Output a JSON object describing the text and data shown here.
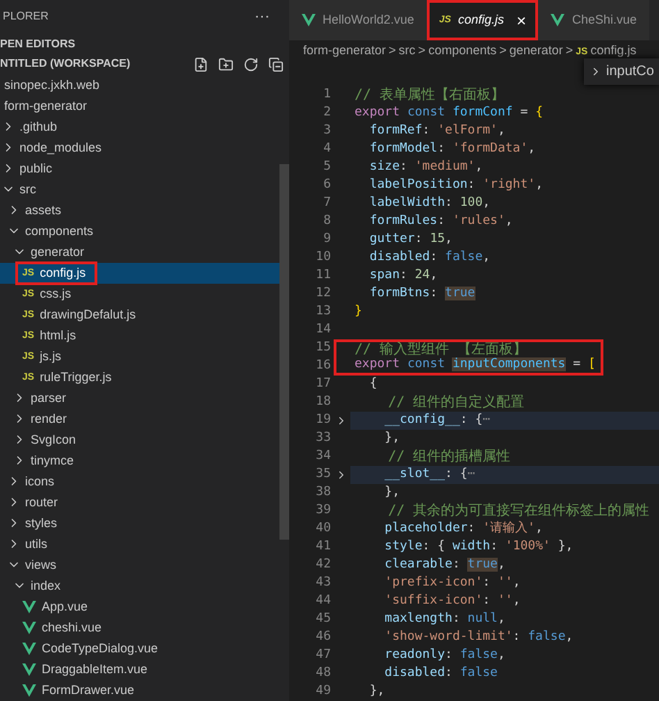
{
  "sidebar": {
    "title": "PLORER",
    "more": "···",
    "open_editors": "PEN EDITORS",
    "workspace": "NTITLED (WORKSPACE)",
    "tree": [
      {
        "label": "sinopec.jxkh.web",
        "kind": "root",
        "selected": false
      },
      {
        "label": "form-generator",
        "kind": "root",
        "selected": false,
        "children": [
          {
            "label": ".github",
            "kind": "folder",
            "expanded": false,
            "selected": false
          },
          {
            "label": "node_modules",
            "kind": "folder",
            "expanded": false,
            "selected": false
          },
          {
            "label": "public",
            "kind": "folder",
            "expanded": false,
            "selected": false
          },
          {
            "label": "src",
            "kind": "folder",
            "expanded": true,
            "selected": false,
            "children": [
              {
                "label": "assets",
                "kind": "folder",
                "expanded": false,
                "selected": false
              },
              {
                "label": "components",
                "kind": "folder",
                "expanded": true,
                "selected": false,
                "children": [
                  {
                    "label": "generator",
                    "kind": "folder",
                    "expanded": true,
                    "selected": false,
                    "children": [
                      {
                        "label": "config.js",
                        "kind": "js",
                        "badge": "JS",
                        "selected": true,
                        "annotated": true
                      },
                      {
                        "label": "css.js",
                        "kind": "js",
                        "badge": "JS",
                        "selected": false,
                        "annotated": false
                      },
                      {
                        "label": "drawingDefalut.js",
                        "kind": "js",
                        "badge": "JS",
                        "selected": false,
                        "annotated": false
                      },
                      {
                        "label": "html.js",
                        "kind": "js",
                        "badge": "JS",
                        "selected": false,
                        "annotated": false
                      },
                      {
                        "label": "js.js",
                        "kind": "js",
                        "badge": "JS",
                        "selected": false,
                        "annotated": false
                      },
                      {
                        "label": "ruleTrigger.js",
                        "kind": "js",
                        "badge": "JS",
                        "selected": false,
                        "annotated": false
                      }
                    ]
                  },
                  {
                    "label": "parser",
                    "kind": "folder",
                    "expanded": false,
                    "selected": false
                  },
                  {
                    "label": "render",
                    "kind": "folder",
                    "expanded": false,
                    "selected": false
                  },
                  {
                    "label": "SvgIcon",
                    "kind": "folder",
                    "expanded": false,
                    "selected": false
                  },
                  {
                    "label": "tinymce",
                    "kind": "folder",
                    "expanded": false,
                    "selected": false
                  }
                ]
              },
              {
                "label": "icons",
                "kind": "folder",
                "expanded": false,
                "selected": false
              },
              {
                "label": "router",
                "kind": "folder",
                "expanded": false,
                "selected": false
              },
              {
                "label": "styles",
                "kind": "folder",
                "expanded": false,
                "selected": false
              },
              {
                "label": "utils",
                "kind": "folder",
                "expanded": false,
                "selected": false
              },
              {
                "label": "views",
                "kind": "folder",
                "expanded": true,
                "selected": false,
                "children": [
                  {
                    "label": "index",
                    "kind": "folder",
                    "expanded": true,
                    "selected": false,
                    "children": [
                      {
                        "label": "App.vue",
                        "kind": "vue",
                        "selected": false,
                        "annotated": false
                      },
                      {
                        "label": "cheshi.vue",
                        "kind": "vue",
                        "selected": false,
                        "annotated": false
                      },
                      {
                        "label": "CodeTypeDialog.vue",
                        "kind": "vue",
                        "selected": false,
                        "annotated": false
                      },
                      {
                        "label": "DraggableItem.vue",
                        "kind": "vue",
                        "selected": false,
                        "annotated": false
                      },
                      {
                        "label": "FormDrawer.vue",
                        "kind": "vue",
                        "selected": false,
                        "annotated": false
                      }
                    ]
                  }
                ]
              }
            ]
          }
        ]
      }
    ]
  },
  "tabs": [
    {
      "label": "HelloWorld2.vue",
      "kind": "vue",
      "selected": false,
      "annotated": false
    },
    {
      "label": "config.js",
      "kind": "js",
      "badge": "JS",
      "selected": true,
      "annotated": true,
      "close": "×"
    },
    {
      "label": "CheShi.vue",
      "kind": "vue",
      "selected": false,
      "annotated": false
    }
  ],
  "breadcrumb": [
    {
      "label": "form-generator",
      "separator": ">"
    },
    {
      "label": "src",
      "separator": ">"
    },
    {
      "label": "components",
      "separator": ">"
    },
    {
      "label": "generator",
      "separator": ">"
    },
    {
      "label": "config.js",
      "badge": "JS"
    }
  ],
  "outline_popup": {
    "label": "inputCo"
  },
  "code": [
    {
      "number": "1",
      "boxed": false,
      "tokens": [
        {
          "kind": "comment",
          "s": "// 表单属性【右面板】"
        }
      ]
    },
    {
      "number": "2",
      "boxed": false,
      "tokens": [
        {
          "kind": "keyword",
          "s": "export "
        },
        {
          "kind": "storage",
          "s": "const "
        },
        {
          "kind": "variable",
          "s": "formConf"
        },
        {
          "kind": "punct",
          "s": " = "
        },
        {
          "kind": "bracket",
          "s": "{"
        }
      ]
    },
    {
      "number": "3",
      "boxed": false,
      "tokens": [
        {
          "kind": "prop",
          "s": "  formRef"
        },
        {
          "kind": "punct",
          "s": ": "
        },
        {
          "kind": "string",
          "s": "'elForm'"
        },
        {
          "kind": "punct",
          "s": ","
        }
      ]
    },
    {
      "number": "4",
      "boxed": false,
      "tokens": [
        {
          "kind": "prop",
          "s": "  formModel"
        },
        {
          "kind": "punct",
          "s": ": "
        },
        {
          "kind": "string",
          "s": "'formData'"
        },
        {
          "kind": "punct",
          "s": ","
        }
      ]
    },
    {
      "number": "5",
      "boxed": false,
      "tokens": [
        {
          "kind": "prop",
          "s": "  size"
        },
        {
          "kind": "punct",
          "s": ": "
        },
        {
          "kind": "string",
          "s": "'medium'"
        },
        {
          "kind": "punct",
          "s": ","
        }
      ]
    },
    {
      "number": "6",
      "boxed": false,
      "tokens": [
        {
          "kind": "prop",
          "s": "  labelPosition"
        },
        {
          "kind": "punct",
          "s": ": "
        },
        {
          "kind": "string",
          "s": "'right'"
        },
        {
          "kind": "punct",
          "s": ","
        }
      ]
    },
    {
      "number": "7",
      "boxed": false,
      "tokens": [
        {
          "kind": "prop",
          "s": "  labelWidth"
        },
        {
          "kind": "punct",
          "s": ": "
        },
        {
          "kind": "number",
          "s": "100"
        },
        {
          "kind": "punct",
          "s": ","
        }
      ]
    },
    {
      "number": "8",
      "boxed": false,
      "tokens": [
        {
          "kind": "prop",
          "s": "  formRules"
        },
        {
          "kind": "punct",
          "s": ": "
        },
        {
          "kind": "string",
          "s": "'rules'"
        },
        {
          "kind": "punct",
          "s": ","
        }
      ]
    },
    {
      "number": "9",
      "boxed": false,
      "tokens": [
        {
          "kind": "prop",
          "s": "  gutter"
        },
        {
          "kind": "punct",
          "s": ": "
        },
        {
          "kind": "number",
          "s": "15"
        },
        {
          "kind": "punct",
          "s": ","
        }
      ]
    },
    {
      "number": "10",
      "boxed": false,
      "tokens": [
        {
          "kind": "prop",
          "s": "  disabled"
        },
        {
          "kind": "punct",
          "s": ": "
        },
        {
          "kind": "literal",
          "s": "false"
        },
        {
          "kind": "punct",
          "s": ","
        }
      ]
    },
    {
      "number": "11",
      "boxed": false,
      "tokens": [
        {
          "kind": "prop",
          "s": "  span"
        },
        {
          "kind": "punct",
          "s": ": "
        },
        {
          "kind": "number",
          "s": "24"
        },
        {
          "kind": "punct",
          "s": ","
        }
      ]
    },
    {
      "number": "12",
      "boxed": false,
      "tokens": [
        {
          "kind": "prop",
          "s": "  formBtns"
        },
        {
          "kind": "punct",
          "s": ": "
        },
        {
          "kind": "literal",
          "s": "true",
          "highlighted": true
        }
      ]
    },
    {
      "number": "13",
      "boxed": false,
      "tokens": [
        {
          "kind": "bracket",
          "s": "}"
        }
      ]
    },
    {
      "number": "14",
      "boxed": false
    },
    {
      "number": "15",
      "boxed": true,
      "tokens": [
        {
          "kind": "comment",
          "s": "// 输入型组件 【左面板】"
        }
      ]
    },
    {
      "number": "16",
      "boxed": true,
      "tokens": [
        {
          "kind": "keyword",
          "s": "export "
        },
        {
          "kind": "storage",
          "s": "const "
        },
        {
          "kind": "variable",
          "s": "inputComponents",
          "highlighted": true
        },
        {
          "kind": "punct",
          "s": " = "
        },
        {
          "kind": "bracket",
          "s": "["
        }
      ]
    },
    {
      "number": "17",
      "boxed": false,
      "tokens": [
        {
          "kind": "punct",
          "s": "  {"
        }
      ]
    },
    {
      "number": "18",
      "boxed": false,
      "tokens": [
        {
          "kind": "comment",
          "s": "    // 组件的自定义配置"
        }
      ]
    },
    {
      "number": "19",
      "boxed": false,
      "folded": true,
      "tokens": [
        {
          "kind": "prop",
          "s": "    __config__"
        },
        {
          "kind": "punct",
          "s": ": {"
        },
        {
          "kind": "fold",
          "s": "⋯"
        }
      ]
    },
    {
      "number": "33",
      "boxed": false,
      "tokens": [
        {
          "kind": "punct",
          "s": "    },"
        }
      ]
    },
    {
      "number": "34",
      "boxed": false,
      "tokens": [
        {
          "kind": "comment",
          "s": "    // 组件的插槽属性"
        }
      ]
    },
    {
      "number": "35",
      "boxed": false,
      "folded": true,
      "tokens": [
        {
          "kind": "prop",
          "s": "    __slot__"
        },
        {
          "kind": "punct",
          "s": ": {"
        },
        {
          "kind": "fold",
          "s": "⋯"
        }
      ]
    },
    {
      "number": "38",
      "boxed": false,
      "tokens": [
        {
          "kind": "punct",
          "s": "    },"
        }
      ]
    },
    {
      "number": "39",
      "boxed": false,
      "tokens": [
        {
          "kind": "comment",
          "s": "    // 其余的为可直接写在组件标签上的属性"
        }
      ]
    },
    {
      "number": "40",
      "boxed": false,
      "tokens": [
        {
          "kind": "prop",
          "s": "    placeholder"
        },
        {
          "kind": "punct",
          "s": ": "
        },
        {
          "kind": "string",
          "s": "'请输入'"
        },
        {
          "kind": "punct",
          "s": ","
        }
      ]
    },
    {
      "number": "41",
      "boxed": false,
      "tokens": [
        {
          "kind": "prop",
          "s": "    style"
        },
        {
          "kind": "punct",
          "s": ": { "
        },
        {
          "kind": "prop",
          "s": "width"
        },
        {
          "kind": "punct",
          "s": ": "
        },
        {
          "kind": "string",
          "s": "'100%'"
        },
        {
          "kind": "punct",
          "s": " },"
        }
      ]
    },
    {
      "number": "42",
      "boxed": false,
      "tokens": [
        {
          "kind": "prop",
          "s": "    clearable"
        },
        {
          "kind": "punct",
          "s": ": "
        },
        {
          "kind": "literal",
          "s": "true",
          "highlighted": true
        },
        {
          "kind": "punct",
          "s": ","
        }
      ]
    },
    {
      "number": "43",
      "boxed": false,
      "tokens": [
        {
          "kind": "string",
          "s": "    'prefix-icon'"
        },
        {
          "kind": "punct",
          "s": ": "
        },
        {
          "kind": "string",
          "s": "''"
        },
        {
          "kind": "punct",
          "s": ","
        }
      ]
    },
    {
      "number": "44",
      "boxed": false,
      "tokens": [
        {
          "kind": "string",
          "s": "    'suffix-icon'"
        },
        {
          "kind": "punct",
          "s": ": "
        },
        {
          "kind": "string",
          "s": "''"
        },
        {
          "kind": "punct",
          "s": ","
        }
      ]
    },
    {
      "number": "45",
      "boxed": false,
      "tokens": [
        {
          "kind": "prop",
          "s": "    maxlength"
        },
        {
          "kind": "punct",
          "s": ": "
        },
        {
          "kind": "literal",
          "s": "null"
        },
        {
          "kind": "punct",
          "s": ","
        }
      ]
    },
    {
      "number": "46",
      "boxed": false,
      "tokens": [
        {
          "kind": "string",
          "s": "    'show-word-limit'"
        },
        {
          "kind": "punct",
          "s": ": "
        },
        {
          "kind": "literal",
          "s": "false"
        },
        {
          "kind": "punct",
          "s": ","
        }
      ]
    },
    {
      "number": "47",
      "boxed": false,
      "tokens": [
        {
          "kind": "prop",
          "s": "    readonly"
        },
        {
          "kind": "punct",
          "s": ": "
        },
        {
          "kind": "literal",
          "s": "false"
        },
        {
          "kind": "punct",
          "s": ","
        }
      ]
    },
    {
      "number": "48",
      "boxed": false,
      "tokens": [
        {
          "kind": "prop",
          "s": "    disabled"
        },
        {
          "kind": "punct",
          "s": ": "
        },
        {
          "kind": "literal",
          "s": "false"
        }
      ]
    },
    {
      "number": "49",
      "boxed": false,
      "tokens": [
        {
          "kind": "punct",
          "s": "  },"
        }
      ]
    }
  ]
}
